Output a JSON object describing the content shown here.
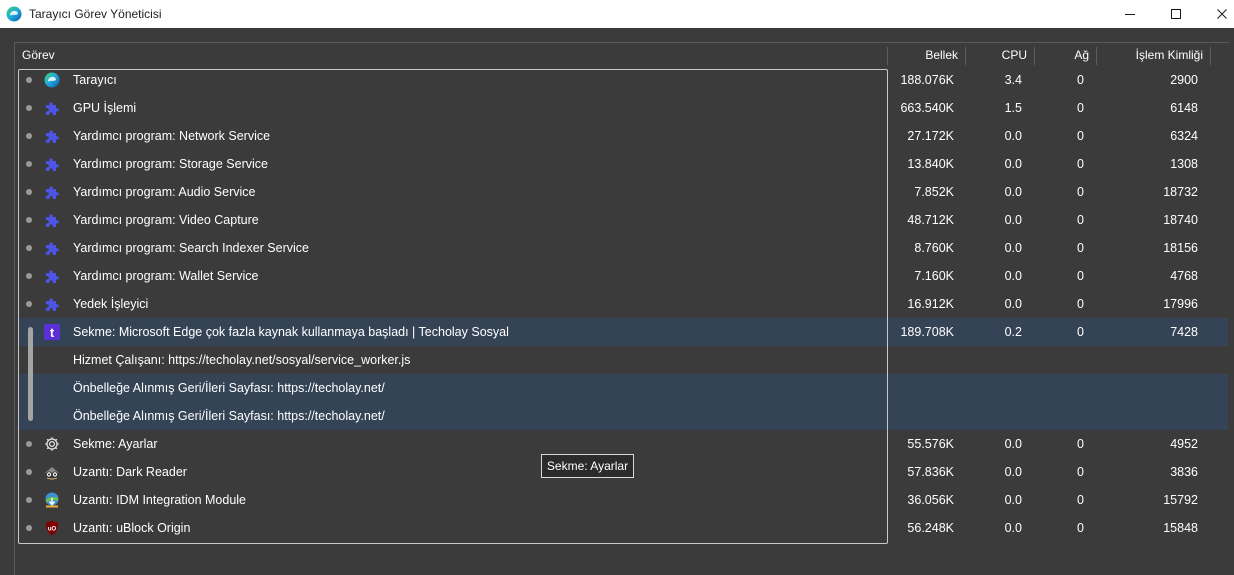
{
  "window": {
    "title": "Tarayıcı Görev Yöneticisi"
  },
  "columns": {
    "task": "Görev",
    "memory": "Bellek",
    "cpu": "CPU",
    "network": "Ağ",
    "pid": "İşlem Kimliği"
  },
  "rows": [
    {
      "icon": "edge-browser-icon",
      "name": "Tarayıcı",
      "memory": "188.076K",
      "cpu": "3.4",
      "network": "0",
      "pid": "2900"
    },
    {
      "icon": "puzzle-piece-icon",
      "name": "GPU İşlemi",
      "memory": "663.540K",
      "cpu": "1.5",
      "network": "0",
      "pid": "6148"
    },
    {
      "icon": "puzzle-piece-icon",
      "name": "Yardımcı program: Network Service",
      "memory": "27.172K",
      "cpu": "0.0",
      "network": "0",
      "pid": "6324"
    },
    {
      "icon": "puzzle-piece-icon",
      "name": "Yardımcı program: Storage Service",
      "memory": "13.840K",
      "cpu": "0.0",
      "network": "0",
      "pid": "1308"
    },
    {
      "icon": "puzzle-piece-icon",
      "name": "Yardımcı program: Audio Service",
      "memory": "7.852K",
      "cpu": "0.0",
      "network": "0",
      "pid": "18732"
    },
    {
      "icon": "puzzle-piece-icon",
      "name": "Yardımcı program: Video Capture",
      "memory": "48.712K",
      "cpu": "0.0",
      "network": "0",
      "pid": "18740"
    },
    {
      "icon": "puzzle-piece-icon",
      "name": "Yardımcı program: Search Indexer Service",
      "memory": "8.760K",
      "cpu": "0.0",
      "network": "0",
      "pid": "18156"
    },
    {
      "icon": "puzzle-piece-icon",
      "name": "Yardımcı program: Wallet Service",
      "memory": "7.160K",
      "cpu": "0.0",
      "network": "0",
      "pid": "4768"
    },
    {
      "icon": "puzzle-piece-icon",
      "name": "Yedek İşleyici",
      "memory": "16.912K",
      "cpu": "0.0",
      "network": "0",
      "pid": "17996"
    },
    {
      "icon": "techolay-favicon-icon",
      "name": "Sekme: Microsoft Edge çok fazla kaynak kullanmaya başladı | Techolay Sosyal",
      "memory": "189.708K",
      "cpu": "0.2",
      "network": "0",
      "pid": "7428",
      "selected": true
    },
    {
      "icon": "",
      "name": "Hizmet Çalışanı: https://techolay.net/sosyal/service_worker.js",
      "memory": "",
      "cpu": "",
      "network": "",
      "pid": ""
    },
    {
      "icon": "",
      "name": "Önbelleğe Alınmış Geri/İleri Sayfası: https://techolay.net/",
      "memory": "",
      "cpu": "",
      "network": "",
      "pid": "",
      "selected": true
    },
    {
      "icon": "",
      "name": "Önbelleğe Alınmış Geri/İleri Sayfası: https://techolay.net/",
      "memory": "",
      "cpu": "",
      "network": "",
      "pid": "",
      "selected": true
    },
    {
      "icon": "gear-icon",
      "name": "Sekme: Ayarlar",
      "memory": "55.576K",
      "cpu": "0.0",
      "network": "0",
      "pid": "4952"
    },
    {
      "icon": "dark-reader-icon",
      "name": "Uzantı: Dark Reader",
      "memory": "57.836K",
      "cpu": "0.0",
      "network": "0",
      "pid": "3836"
    },
    {
      "icon": "idm-icon",
      "name": "Uzantı: IDM Integration Module",
      "memory": "36.056K",
      "cpu": "0.0",
      "network": "0",
      "pid": "15792"
    },
    {
      "icon": "ublock-origin-icon",
      "name": "Uzantı: uBlock Origin",
      "memory": "56.248K",
      "cpu": "0.0",
      "network": "0",
      "pid": "15848"
    }
  ],
  "tooltip": {
    "text": "Sekme: Ayarlar"
  },
  "colors": {
    "background": "#3b3b3b",
    "selection": "#344456",
    "puzzle": "#4d55e6",
    "titlebar": "#ffffff"
  }
}
